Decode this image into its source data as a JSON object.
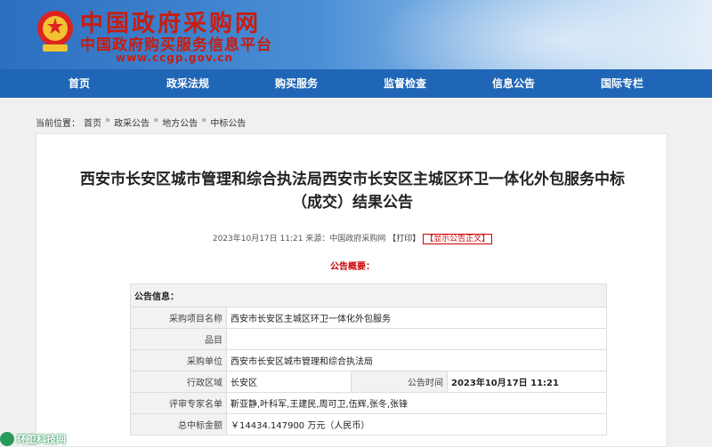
{
  "header": {
    "title": "中国政府采购网",
    "subtitle": "中国政府购买服务信息平台",
    "url": "www.ccgp.gov.cn"
  },
  "nav": {
    "items": [
      {
        "label": "首页"
      },
      {
        "label": "政采法规"
      },
      {
        "label": "购买服务"
      },
      {
        "label": "监督检查"
      },
      {
        "label": "信息公告"
      },
      {
        "label": "国际专栏"
      }
    ]
  },
  "breadcrumb": {
    "prefix": "当前位置：",
    "items": [
      "首页",
      "政采公告",
      "地方公告",
      "中标公告"
    ],
    "separator": "»"
  },
  "notice": {
    "title_line1": "西安市长安区城市管理和综合执法局西安市长安区主城区环卫一体化外包服务中标",
    "title_line2": "（成交）结果公告",
    "date": "2023年10月17日 11:21",
    "source_label": "来源：",
    "source": "中国政府采购网",
    "print": "【打印】",
    "show_notice": "【显示公告正文】",
    "summary_label": "公告概要："
  },
  "info_table": {
    "header": "公告信息：",
    "project_name_label": "采购项目名称",
    "project_name": "西安市长安区主城区环卫一体化外包服务",
    "item_label": "品目",
    "item": "",
    "unit_label": "采购单位",
    "unit": "西安市长安区城市管理和综合执法局",
    "region_label": "行政区域",
    "region": "长安区",
    "time_label": "公告时间",
    "time": "2023年10月17日 11:21",
    "experts_label": "评审专家名单",
    "experts": "靳亚静,叶科军,王建民,周可卫,伍辉,张冬,张锋",
    "amount_label": "总中标金额",
    "amount": "￥14434.147900 万元（人民币）"
  },
  "watermark": {
    "text": "环卫科技网"
  },
  "colors": {
    "nav_bg": "#2066b6",
    "title_red": "#c81d10",
    "accent_red": "#cc0000"
  }
}
